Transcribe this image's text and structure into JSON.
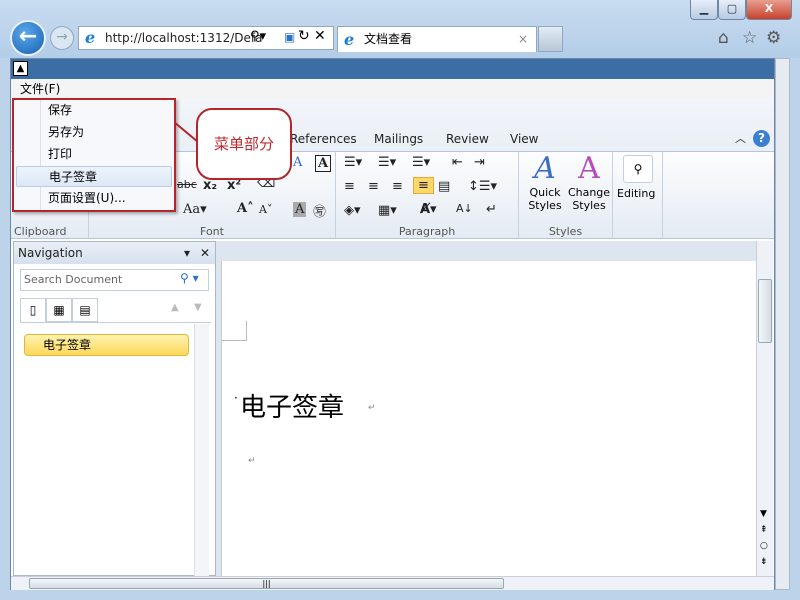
{
  "browser": {
    "url": "http://localhost:1312/Defa",
    "tab_title": "文档查看",
    "window_buttons": [
      "minimize",
      "maximize",
      "close"
    ]
  },
  "app": {
    "menubar": {
      "file": "文件(F)"
    }
  },
  "file_menu": {
    "items": [
      {
        "label": "保存"
      },
      {
        "label": "另存为"
      },
      {
        "label": "打印"
      },
      {
        "label": "电子签章",
        "highlighted": true
      },
      {
        "label": "页面设置(U)..."
      }
    ]
  },
  "callout": {
    "text": "菜单部分"
  },
  "ribbon": {
    "tabs": [
      "References",
      "Mailings",
      "Review",
      "View"
    ],
    "groups": {
      "clipboard": "Clipboard",
      "font": "Font",
      "paragraph": "Paragraph",
      "styles": "Styles"
    },
    "quick_styles": [
      "Quick",
      "Styles"
    ],
    "change_styles": [
      "Change",
      "Styles"
    ],
    "editing": "Editing"
  },
  "navigation": {
    "title": "Navigation",
    "search_placeholder": "Search Document",
    "headings": [
      "电子签章"
    ]
  },
  "document": {
    "heading": "电子签章"
  },
  "colors": {
    "accent_red": "#b3262b",
    "title_bar": "#3a6ea5",
    "heading_highlight": "#fdd85a"
  }
}
